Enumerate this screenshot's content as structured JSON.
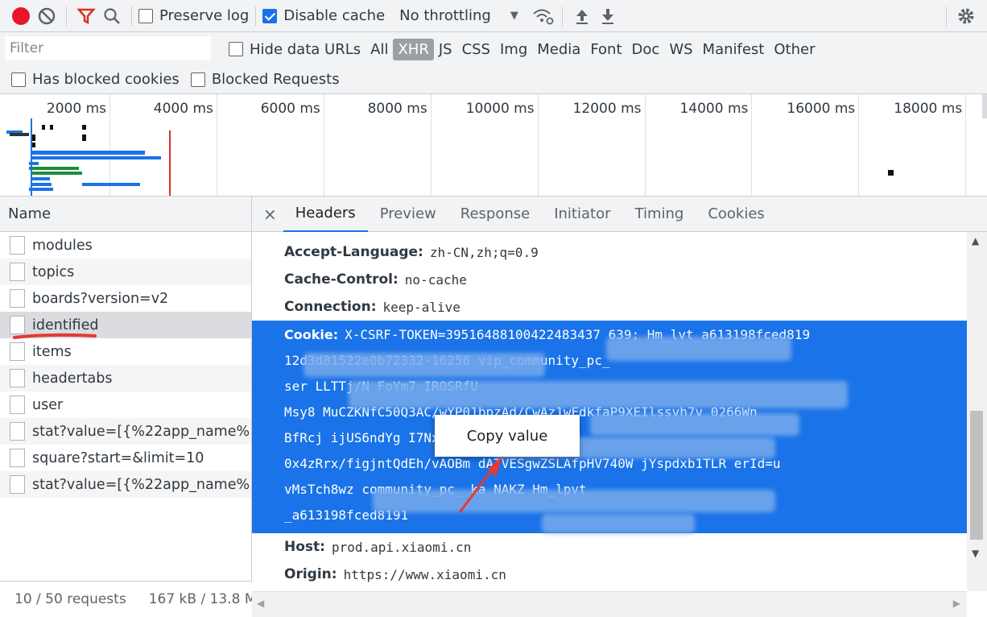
{
  "toolbar": {
    "preserve_log": "Preserve log",
    "disable_cache": "Disable cache",
    "throttling": "No throttling"
  },
  "filterbar": {
    "placeholder": "Filter",
    "hide_data_urls": "Hide data URLs",
    "types": [
      "All",
      "XHR",
      "JS",
      "CSS",
      "Img",
      "Media",
      "Font",
      "Doc",
      "WS",
      "Manifest",
      "Other"
    ],
    "active_type": "XHR"
  },
  "cookiebar": {
    "has_blocked": "Has blocked cookies",
    "blocked_requests": "Blocked Requests"
  },
  "overview": {
    "ticks": [
      "2000 ms",
      "4000 ms",
      "6000 ms",
      "8000 ms",
      "10000 ms",
      "12000 ms",
      "14000 ms",
      "16000 ms",
      "18000 ms"
    ]
  },
  "requests": {
    "header": "Name",
    "items": [
      "modules",
      "topics",
      "boards?version=v2",
      "identified",
      "items",
      "headertabs",
      "user",
      "stat?value=[{%22app_name%...",
      "square?start=&limit=10",
      "stat?value=[{%22app_name%..."
    ],
    "selected_index": 3,
    "status_count": "10 / 50 requests",
    "status_size": "167 kB / 13.8 M"
  },
  "details": {
    "close": "×",
    "tabs": [
      "Headers",
      "Preview",
      "Response",
      "Initiator",
      "Timing",
      "Cookies"
    ],
    "active_tab": "Headers",
    "headers": [
      {
        "k": "Accept-Language:",
        "v": "zh-CN,zh;q=0.9"
      },
      {
        "k": "Cache-Control:",
        "v": "no-cache"
      },
      {
        "k": "Connection:",
        "v": "keep-alive"
      }
    ],
    "cookie": {
      "k": "Cookie:",
      "lines": [
        "X-CSRF-TOKEN=39516488100422483437                639; Hm_lvt_a613198fced819",
        "12d3d81522e0b72332-16256                                   vip_community_pc_",
        "ser                                                  LLTTj/N FoYm7  IROSRfU",
        "Msy8      MuCZKNfC50Q3AC/wYP01bpzAd/CwAz1wFdkfaP9XEIlssvh7v            0266Wn",
        "BfRcj   ijUS6ndYg                    I7NxrN7H7IFg6cc              6FV4p7",
        "0x4zRrx/figjntQdEh/vAOBm   dATVESgwZSLAfpHV740W          jYspdxb1TLR      erId=u",
        "vMsTch8wz                    community_pc_       ka      NAKZ          Hm_lpvt",
        "_a613198fced8191"
      ]
    },
    "after": [
      {
        "k": "Host:",
        "v": "prod.api.xiaomi.cn"
      },
      {
        "k": "Origin:",
        "v": "https://www.xiaomi.cn"
      }
    ]
  },
  "context_menu": {
    "copy_value": "Copy value"
  },
  "colors": {
    "selection": "#1a73e8",
    "record": "#e8152b",
    "annotation": "#e53935"
  }
}
